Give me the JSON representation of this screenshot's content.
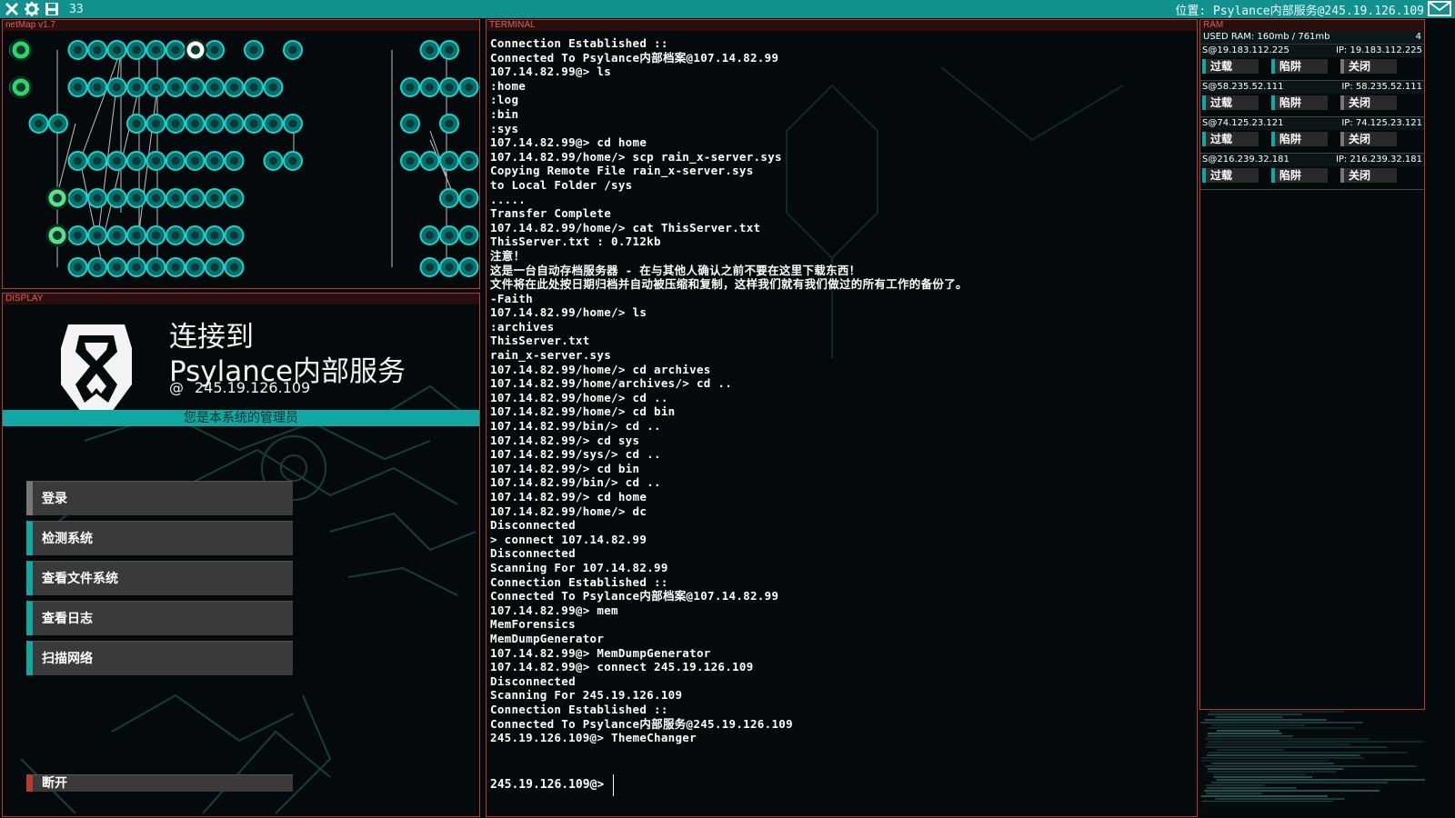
{
  "topbar": {
    "count": "33",
    "location": "位置: Psylance内部服务@245.19.126.109",
    "icons": [
      "close-icon",
      "gear-icon",
      "save-icon",
      "mail-icon"
    ]
  },
  "netmap": {
    "title": "netMap v1.7"
  },
  "display": {
    "title": "DISPLAY",
    "connected_to": "连接到",
    "server_name": "Psylance内部服务",
    "at": "@",
    "ip": "245.19.126.109",
    "admin_text": "您是本系统的管理员",
    "menu": [
      "登录",
      "检测系统",
      "查看文件系统",
      "查看日志",
      "扫描网络"
    ],
    "disconnect": "断开"
  },
  "terminal": {
    "title": "TERMINAL",
    "lines": [
      "Connection Established ::",
      "Connected To Psylance内部档案@107.14.82.99",
      "107.14.82.99@> ls",
      ":home",
      ":log",
      ":bin",
      ":sys",
      "107.14.82.99@> cd home",
      "107.14.82.99/home/> scp rain_x-server.sys",
      "Copying Remote File rain_x-server.sys",
      "to Local Folder /sys",
      ".....",
      "Transfer Complete",
      "107.14.82.99/home/> cat ThisServer.txt",
      "ThisServer.txt : 0.712kb",
      "注意！",
      "这是一台自动存档服务器 - 在与其他人确认之前不要在这里下载东西！",
      "文件将在此处按日期归档并自动被压缩和复制，这样我们就有我们做过的所有工作的备份了。",
      "-Faith",
      "107.14.82.99/home/> ls",
      ":archives",
      "ThisServer.txt",
      "rain_x-server.sys",
      "107.14.82.99/home/> cd archives",
      "107.14.82.99/home/archives/> cd ..",
      "107.14.82.99/home/> cd ..",
      "107.14.82.99/home/> cd bin",
      "107.14.82.99/bin/> cd ..",
      "107.14.82.99/> cd sys",
      "107.14.82.99/sys/> cd ..",
      "107.14.82.99/> cd bin",
      "107.14.82.99/bin/> cd ..",
      "107.14.82.99/> cd home",
      "107.14.82.99/home/> dc",
      "Disconnected",
      "> connect 107.14.82.99",
      "Disconnected",
      "Scanning For 107.14.82.99",
      "Connection Established ::",
      "Connected To Psylance内部档案@107.14.82.99",
      "107.14.82.99@> mem",
      "MemForensics",
      "MemDumpGenerator",
      "107.14.82.99@> MemDumpGenerator",
      "107.14.82.99@> connect 245.19.126.109",
      "Disconnected",
      "Scanning For 245.19.126.109",
      "Connection Established ::",
      "Connected To Psylance内部服务@245.19.126.109",
      "245.19.126.109@> ThemeChanger"
    ],
    "prompt": "245.19.126.109@>"
  },
  "ram": {
    "title": "RAM",
    "used_label": "USED RAM: 160mb / 761mb",
    "used_count": "4",
    "processes": [
      {
        "id": "S@19.183.112.225",
        "ip": "IP: 19.183.112.225"
      },
      {
        "id": "S@58.235.52.111",
        "ip": "IP: 58.235.52.111"
      },
      {
        "id": "S@74.125.23.121",
        "ip": "IP: 74.125.23.121"
      },
      {
        "id": "S@216.239.32.181",
        "ip": "IP: 216.239.32.181"
      }
    ],
    "btn_overload": "过载",
    "btn_trap": "陷阱",
    "btn_close": "关闭"
  },
  "colors": {
    "accent": "#12a7a3",
    "border": "#b93a30",
    "panel_title": "#e06052"
  }
}
